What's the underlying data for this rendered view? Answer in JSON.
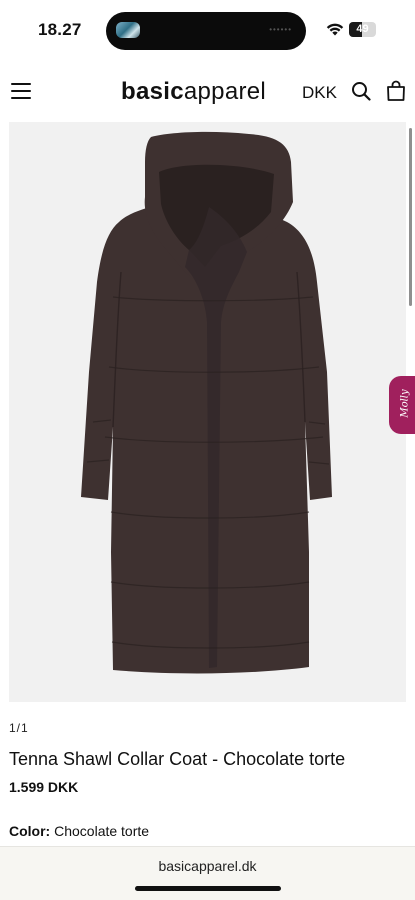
{
  "status_bar": {
    "time": "18.27",
    "battery_level": "49",
    "battery_fraction": 0.49,
    "wifi_icon": "wifi-icon"
  },
  "header": {
    "logo_bold": "basic",
    "logo_light": "apparel",
    "currency": "DKK",
    "menu_icon": "hamburger-menu-icon",
    "search_icon": "search-icon",
    "bag_icon": "shopping-bag-icon"
  },
  "chat_widget": {
    "label": "Molly",
    "color": "#a0205d"
  },
  "product": {
    "image_counter": "1/1",
    "title": "Tenna Shawl Collar Coat - Chocolate torte",
    "price": "1.599 DKK",
    "color_label": "Color:",
    "color_value": " Chocolate torte",
    "coat_color": "#3e3130"
  },
  "browser": {
    "url": "basicapparel.dk"
  }
}
